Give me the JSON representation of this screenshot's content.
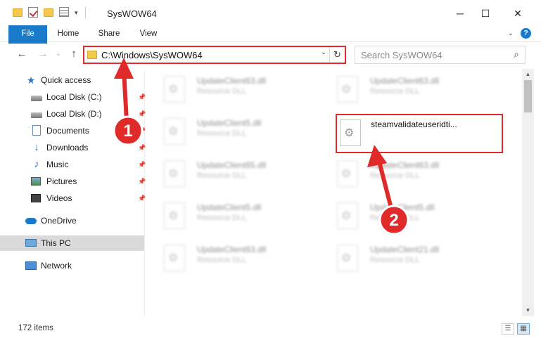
{
  "window": {
    "title": "SysWOW64",
    "minimize_glyph": "─",
    "maximize_glyph": "☐",
    "close_glyph": "✕"
  },
  "quick_access_toolbar": [
    "folder-icon",
    "properties-check-icon",
    "new-folder-icon",
    "properties-icon",
    "customize-caret-icon"
  ],
  "ribbon": {
    "tabs": [
      {
        "label": "File",
        "active": true
      },
      {
        "label": "Home"
      },
      {
        "label": "Share"
      },
      {
        "label": "View"
      }
    ],
    "expand_glyph": "⌄",
    "help_glyph": "?"
  },
  "navigation": {
    "back_glyph": "←",
    "forward_glyph": "→",
    "up_glyph": "↑",
    "recent_glyph": "⌄",
    "address_path": "C:\\Windows\\SysWOW64",
    "address_dropdown_glyph": "⌄",
    "refresh_glyph": "↻",
    "search_placeholder": "Search SysWOW64",
    "search_glyph": "⌕"
  },
  "sidebar": {
    "items": [
      {
        "label": "Quick access",
        "icon": "star-icon",
        "pinned": false
      },
      {
        "label": "Local Disk (C:)",
        "icon": "disk-icon",
        "pinned": true
      },
      {
        "label": "Local Disk (D:)",
        "icon": "disk-icon",
        "pinned": true
      },
      {
        "label": "Documents",
        "icon": "documents-icon",
        "pinned": true
      },
      {
        "label": "Downloads",
        "icon": "downloads-icon",
        "pinned": true
      },
      {
        "label": "Music",
        "icon": "music-icon",
        "pinned": true
      },
      {
        "label": "Pictures",
        "icon": "pictures-icon",
        "pinned": true
      },
      {
        "label": "Videos",
        "icon": "videos-icon",
        "pinned": true
      },
      {
        "label": "OneDrive",
        "icon": "onedrive-icon",
        "pinned": false
      },
      {
        "label": "This PC",
        "icon": "this-pc-icon",
        "pinned": false,
        "selected": true
      },
      {
        "label": "Network",
        "icon": "network-icon",
        "pinned": false
      }
    ],
    "pin_glyph": "📌"
  },
  "files": {
    "left_column": [
      {
        "name": "UpdateClient63.dll",
        "type": "Resource DLL"
      },
      {
        "name": "UpdateClient5.dll",
        "type": "Resource DLL"
      },
      {
        "name": "UpdateClient65.dll",
        "type": "Resource DLL"
      },
      {
        "name": "UpdateClient5.dll",
        "type": "Resource DLL"
      },
      {
        "name": "UpdateClient63.dll",
        "type": "Resource DLL"
      }
    ],
    "right_column": [
      {
        "name": "UpdateClient63.dll",
        "type": "Resource DLL"
      },
      {
        "name": "steamvalidateuseridti...",
        "type": "",
        "highlighted": true
      },
      {
        "name": "UpdateClient63.dll",
        "type": "Resource DLL"
      },
      {
        "name": "UpdateClient5.dll",
        "type": "Resource DLL"
      },
      {
        "name": "UpdateClient21.dll",
        "type": "Resource DLL"
      }
    ]
  },
  "scrollbar": {
    "up_glyph": "▲",
    "down_glyph": "▼"
  },
  "status": {
    "item_count": "172 items",
    "details_view_glyph": "☰",
    "large_icons_glyph": "▦"
  },
  "annotations": {
    "step1": "1",
    "step2": "2",
    "accent_color": "#e02a2a"
  }
}
